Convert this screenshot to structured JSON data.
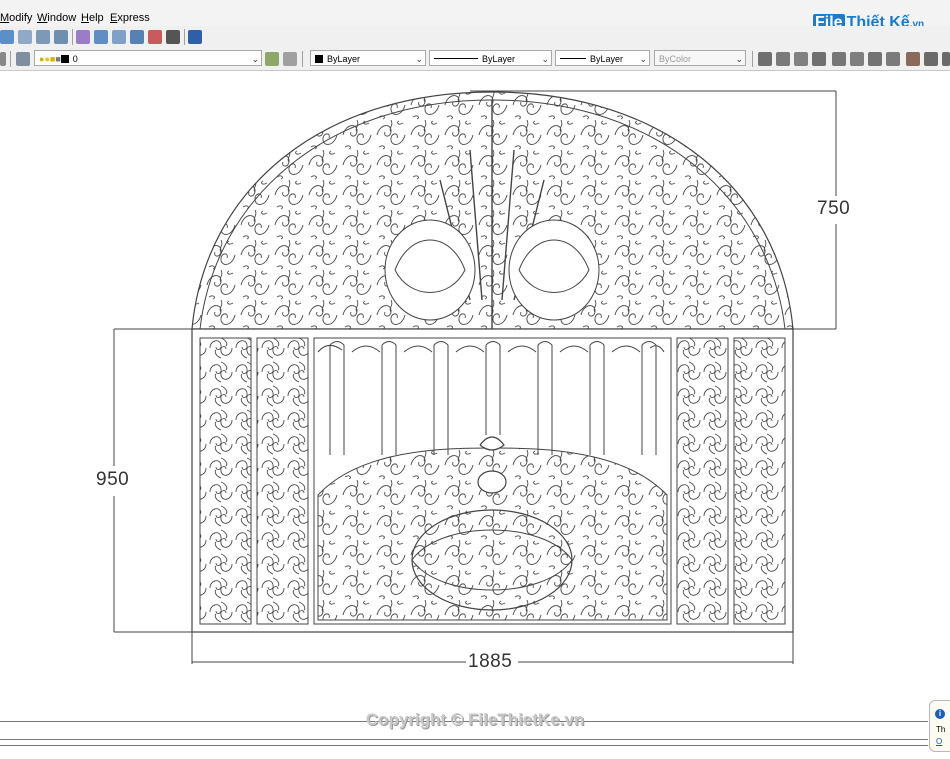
{
  "menu": {
    "items": [
      "Modify",
      "Window",
      "Help",
      "Express"
    ]
  },
  "watermark_logo": {
    "file": "File",
    "name": "Thiết Kế",
    "domain": ".vn"
  },
  "layer_toolbar": {
    "current_layer": "0"
  },
  "properties_toolbar": {
    "color": "ByLayer",
    "linetype": "ByLayer",
    "lineweight": "ByLayer",
    "plotstyle": "ByColor"
  },
  "drawing": {
    "dimension_arch_height": "750",
    "dimension_panel_height": "950",
    "dimension_width": "1885"
  },
  "footer": {
    "copyright": "Copyright © FileThietKe.vn"
  },
  "notification": {
    "icon": "info-icon",
    "line1": "Th",
    "line2": "O"
  },
  "colors": {
    "line": "#444444",
    "dimension": "#333333",
    "logo_blue": "#1a7bd1"
  }
}
